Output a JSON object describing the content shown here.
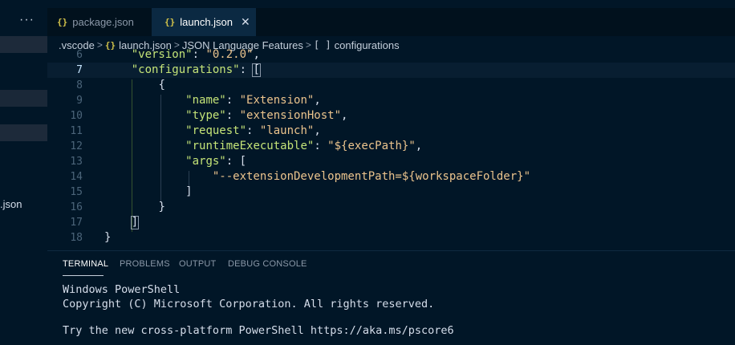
{
  "sidebar": {
    "more": "···",
    "file_fragment": ".json"
  },
  "tabs": [
    {
      "icon": "{}",
      "label": "package.json"
    },
    {
      "icon": "{}",
      "label": "launch.json",
      "close": "✕"
    }
  ],
  "breadcrumb": {
    "folder": ".vscode",
    "file_icon": "{}",
    "file": "launch.json",
    "section": "JSON Language Features",
    "node_icon": "[ ]",
    "node": "configurations",
    "sep": ">"
  },
  "editor": {
    "lines": [
      {
        "num": "6",
        "a": "    ",
        "k1": "\"version\"",
        "p1": ": ",
        "s1": "\"0.2.0\"",
        "p2": ","
      },
      {
        "num": "7",
        "a": "    ",
        "k1": "\"configurations\"",
        "p1": ": ",
        "s1": "",
        "p2": "["
      },
      {
        "num": "8",
        "a": "        ",
        "k1": "",
        "p1": "{",
        "s1": "",
        "p2": ""
      },
      {
        "num": "9",
        "a": "            ",
        "k1": "\"name\"",
        "p1": ": ",
        "s1": "\"Extension\"",
        "p2": ","
      },
      {
        "num": "10",
        "a": "            ",
        "k1": "\"type\"",
        "p1": ": ",
        "s1": "\"extensionHost\"",
        "p2": ","
      },
      {
        "num": "11",
        "a": "            ",
        "k1": "\"request\"",
        "p1": ": ",
        "s1": "\"launch\"",
        "p2": ","
      },
      {
        "num": "12",
        "a": "            ",
        "k1": "\"runtimeExecutable\"",
        "p1": ": ",
        "s1": "\"${execPath}\"",
        "p2": ","
      },
      {
        "num": "13",
        "a": "            ",
        "k1": "\"args\"",
        "p1": ": [",
        "s1": "",
        "p2": ""
      },
      {
        "num": "14",
        "a": "                ",
        "k1": "",
        "p1": "",
        "s1": "\"--extensionDevelopmentPath=${workspaceFolder}\"",
        "p2": ""
      },
      {
        "num": "15",
        "a": "            ",
        "k1": "",
        "p1": "]",
        "s1": "",
        "p2": ""
      },
      {
        "num": "16",
        "a": "        ",
        "k1": "",
        "p1": "}",
        "s1": "",
        "p2": ""
      },
      {
        "num": "17",
        "a": "    ",
        "k1": "",
        "p1": "]",
        "s1": "",
        "p2": ""
      },
      {
        "num": "18",
        "a": "",
        "k1": "",
        "p1": "}",
        "s1": "",
        "p2": ""
      }
    ]
  },
  "panel": {
    "tabs": [
      "TERMINAL",
      "PROBLEMS",
      "OUTPUT",
      "DEBUG CONSOLE"
    ],
    "terminal": [
      "Windows PowerShell",
      "Copyright (C) Microsoft Corporation. All rights reserved.",
      "",
      "Try the new cross-platform PowerShell https://aka.ms/pscore6"
    ]
  },
  "colors": {
    "background": "#011627",
    "key": "#c5e478",
    "string": "#ecc48d",
    "json_icon": "#d4c44a"
  }
}
